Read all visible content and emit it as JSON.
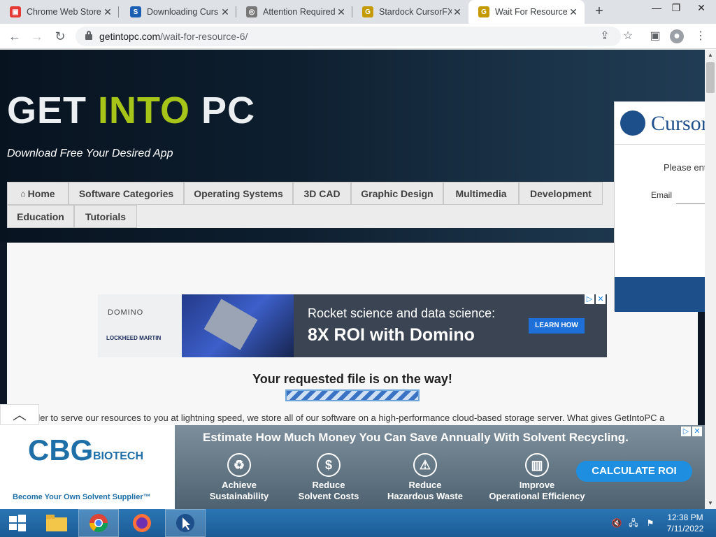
{
  "tabs": [
    {
      "title": "Chrome Web Store",
      "icon": "chrome-store-icon",
      "color": "#e53935"
    },
    {
      "title": "Downloading Curs",
      "icon": "stardock-icon",
      "color": "#1a5fb4"
    },
    {
      "title": "Attention Required",
      "icon": "globe-icon",
      "color": "#777777"
    },
    {
      "title": "Stardock CursorFX",
      "icon": "getintopc-icon",
      "color": "#c49a00"
    },
    {
      "title": "Wait For Resource",
      "icon": "getintopc-icon",
      "color": "#c49a00"
    }
  ],
  "toolbar": {
    "url_host": "getintopc.com",
    "url_path": "/wait-for-resource-6/"
  },
  "site": {
    "logo_get": "GET ",
    "logo_into": "INTO",
    "logo_pc": " PC",
    "tagline": "Download Free Your Desired App",
    "menu": [
      "Home",
      "Software Categories",
      "Operating Systems",
      "3D CAD",
      "Graphic Design",
      "Multimedia",
      "Development",
      "Education",
      "Tutorials"
    ],
    "file_message": "Your requested file is on the way!",
    "description": "der to serve our resources to you at lightning speed, we store all of our software on a high-performance cloud-based storage server. What gives GetIntoPC a"
  },
  "ad_top": {
    "brand1": "DOMINO",
    "brand2": "LOCKHEED MARTIN",
    "headline1": "Rocket science and data science:",
    "headline2": "8X ROI with Domino",
    "cta": "LEARN HOW"
  },
  "ad_bottom": {
    "logo": "CBG",
    "logo_sub": "BIOTECH",
    "tagline": "Become Your Own Solvent Supplier™",
    "headline": "Estimate How Much Money You Can Save Annually With Solvent Recycling.",
    "features": [
      {
        "l1": "Achieve",
        "l2": "Sustainability"
      },
      {
        "l1": "Reduce",
        "l2": "Solvent Costs"
      },
      {
        "l1": "Reduce",
        "l2": "Hazardous Waste"
      },
      {
        "l1": "Improve",
        "l2": "Operational Efficiency"
      }
    ],
    "cta": "CALCULATE ROI"
  },
  "popup": {
    "title": "Cursor",
    "prompt": "Please enter",
    "email_label": "Email"
  },
  "taskbar": {
    "time": "12:38 PM",
    "date": "7/11/2022"
  }
}
